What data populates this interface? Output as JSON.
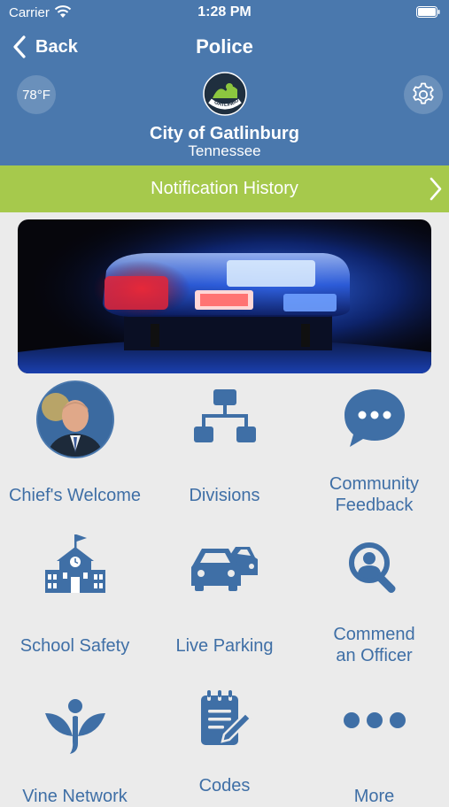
{
  "status_bar": {
    "carrier": "Carrier",
    "time": "1:28 PM"
  },
  "nav": {
    "back_label": "Back",
    "title": "Police"
  },
  "header": {
    "temperature": "78°F",
    "city": "City of Gatlinburg",
    "state": "Tennessee",
    "logo_text": "GATLINBURG"
  },
  "notification_bar": {
    "label": "Notification History"
  },
  "tiles": [
    {
      "label": "Chief's Welcome",
      "icon": "chief-portrait"
    },
    {
      "label": "Divisions",
      "icon": "org-chart-icon"
    },
    {
      "label": "Community\nFeedback",
      "icon": "chat-bubble-icon"
    },
    {
      "label": "School Safety",
      "icon": "school-icon"
    },
    {
      "label": "Live Parking",
      "icon": "cars-icon"
    },
    {
      "label": "Commend\nan Officer",
      "icon": "search-user-icon"
    },
    {
      "label": "Vine Network",
      "icon": "vine-icon"
    },
    {
      "label": "Codes",
      "icon": "notepad-icon"
    },
    {
      "label": "More",
      "icon": "more-icon"
    }
  ],
  "colors": {
    "header_bg": "#4a78ad",
    "accent_green": "#a6c94c",
    "tile_text": "#3f6fa6",
    "page_bg": "#ebebeb"
  }
}
